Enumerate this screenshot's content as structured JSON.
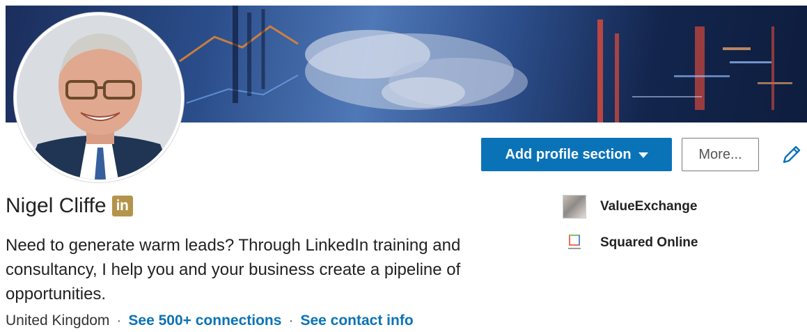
{
  "profile": {
    "name": "Nigel Cliffe",
    "badge": "in",
    "headline": "Need to generate warm leads? Through LinkedIn training and consultancy, I help you and your business create a pipeline of opportunities.",
    "location": "United Kingdom",
    "separator": "·",
    "connections_link": "See 500+ connections",
    "contact_link": "See contact info"
  },
  "actions": {
    "add_section_label": "Add profile section",
    "more_label": "More..."
  },
  "side": [
    {
      "label": "ValueExchange",
      "icon": "valueexchange-logo"
    },
    {
      "label": "Squared Online",
      "icon": "squared-online-logo"
    }
  ],
  "colors": {
    "accent": "#0a73b8",
    "badge": "#b4944a",
    "text": "#222222"
  }
}
